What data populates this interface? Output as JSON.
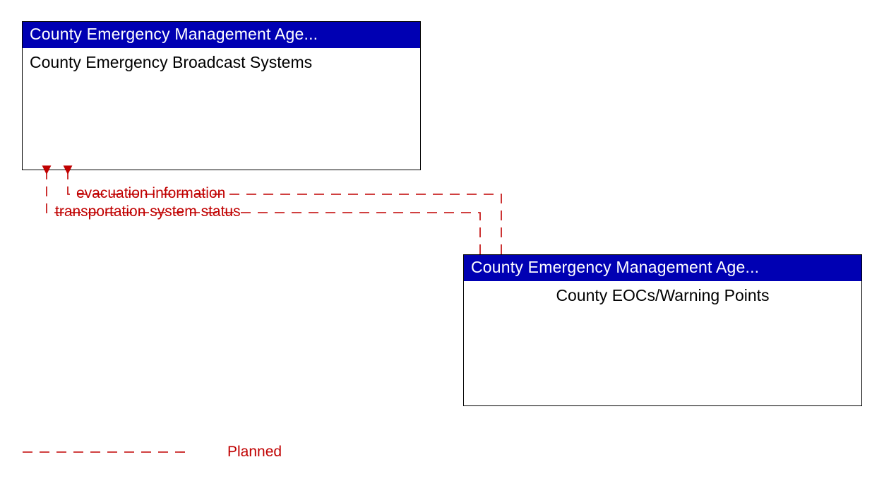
{
  "colors": {
    "header_bg": "#0000b3",
    "flow": "#c00000",
    "border": "#000000"
  },
  "node_left": {
    "header": "County Emergency Management Age...",
    "body": "County Emergency Broadcast Systems"
  },
  "node_right": {
    "header": "County Emergency Management Age...",
    "body": "County EOCs/Warning Points"
  },
  "flows": {
    "f1": "evacuation information",
    "f2": "transportation system status"
  },
  "legend": {
    "planned": "Planned"
  }
}
